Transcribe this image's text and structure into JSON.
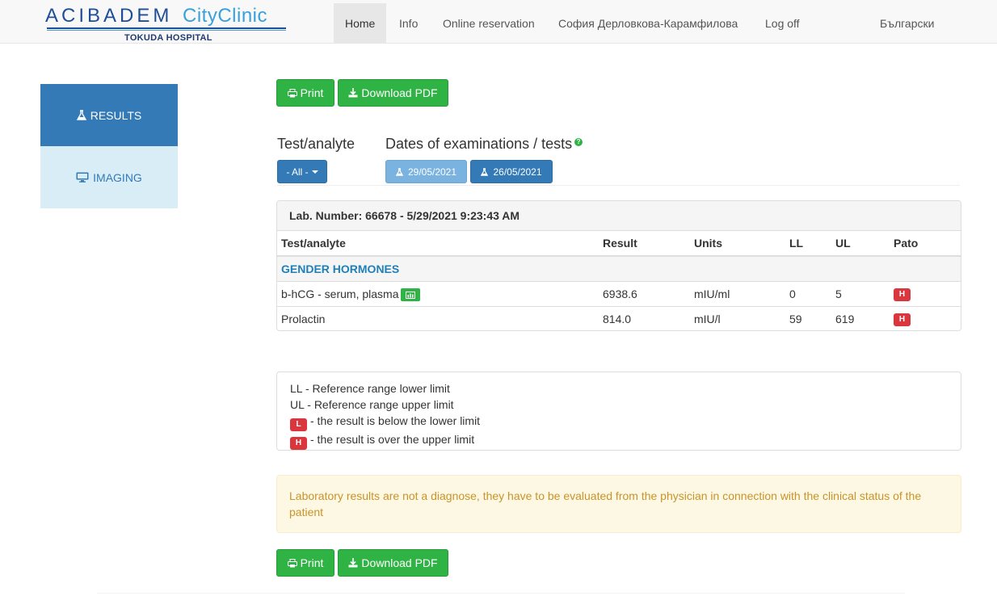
{
  "brand": {
    "name": "ACIBADEM",
    "subname": "CityClinic",
    "tagline": "TOKUDA HOSPITAL"
  },
  "nav": {
    "home": "Home",
    "info": "Info",
    "reservation": "Online reservation",
    "user": "София Дерловкова-Карамфилова",
    "logoff": "Log off",
    "language": "Български"
  },
  "sidebar": {
    "results": "RESULTS",
    "imaging": "IMAGING"
  },
  "actions": {
    "print": "Print",
    "download": "Download PDF"
  },
  "filters": {
    "test_title": "Test/analyte",
    "dates_title": "Dates of examinations / tests",
    "all_label": "- All -",
    "dates": [
      "29/05/2021",
      "26/05/2021"
    ]
  },
  "panel": {
    "heading": "Lab. Number: 66678 - 5/29/2021 9:23:43 AM",
    "columns": [
      "Test/analyte",
      "Result",
      "Units",
      "LL",
      "UL",
      "Pato"
    ],
    "group": "GENDER HORMONES",
    "rows": [
      {
        "name": "b-hCG - serum, plasma",
        "result": "6938.6",
        "units": "mIU/ml",
        "ll": "0",
        "ul": "5",
        "flag": "H"
      },
      {
        "name": "Prolactin",
        "result": "814.0",
        "units": "mIU/l",
        "ll": "59",
        "ul": "619",
        "flag": "H"
      }
    ]
  },
  "legend": {
    "ll": "LL - Reference range lower limit",
    "ul": "UL - Reference range upper limit",
    "low_flag": "L",
    "low_text": "- the result is below the lower limit",
    "high_flag": "H",
    "high_text": "- the result is over the upper limit"
  },
  "warning": "Laboratory results are not a diagnose, they have to be evaluated from the physician in connection with the clinical status of the patient",
  "colors": {
    "primary": "#337ab7",
    "success": "#2fb344",
    "danger": "#d9363e",
    "warning_text": "#c9932a"
  }
}
